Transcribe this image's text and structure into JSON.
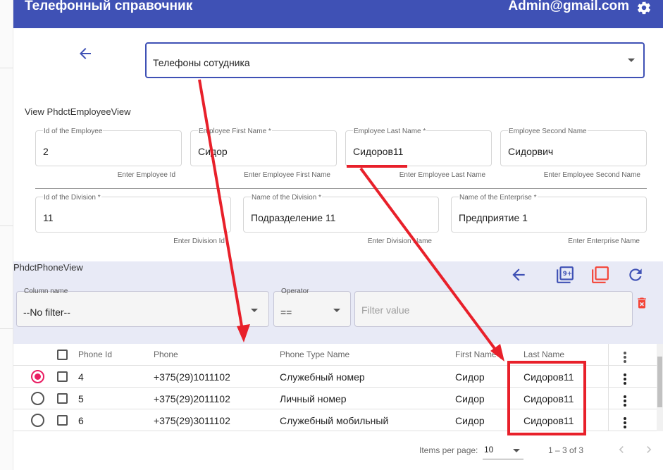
{
  "app": {
    "title": "Телефонный справочник",
    "user": "Admin@gmail.com",
    "settings_icon": "gear-icon"
  },
  "selector": {
    "value": "Телефоны сотудника"
  },
  "employee_view": {
    "title": "View PhdctEmployeeView",
    "fields": {
      "id": {
        "label": "Id of the Employee",
        "value": "2",
        "hint": "Enter Employee Id"
      },
      "first_name": {
        "label": "Employee First Name *",
        "value": "Сидор",
        "hint": "Enter Employee First Name"
      },
      "last_name": {
        "label": "Employee Last Name *",
        "value": "Сидоров11",
        "hint": "Enter Employee Last Name"
      },
      "second_name": {
        "label": "Employee Second Name",
        "value": "Сидорвич",
        "hint": "Enter Employee Second Name"
      },
      "division_id": {
        "label": "Id of the Division *",
        "value": "11",
        "hint": "Enter Division Id"
      },
      "division_name": {
        "label": "Name of the Division *",
        "value": "Подразделение 11",
        "hint": "Enter Division Name"
      },
      "enterprise_name": {
        "label": "Name of the Enterprise *",
        "value": "Предприятие 1",
        "hint": "Enter Enterprise Name"
      }
    }
  },
  "phone_view": {
    "title": "PhdctPhoneView",
    "filter": {
      "column_label": "Column name",
      "column_value": "--No filter--",
      "operator_label": "Operator",
      "operator_value": "==",
      "value_placeholder": "Filter value"
    },
    "columns": [
      "Phone Id",
      "Phone",
      "Phone Type Name",
      "First Name",
      "Last Name"
    ],
    "rows": [
      {
        "selected": true,
        "id": "4",
        "phone": "+375(29)1011102",
        "type": "Служебный номер",
        "first": "Сидор",
        "last": "Сидоров11"
      },
      {
        "selected": false,
        "id": "5",
        "phone": "+375(29)2011102",
        "type": "Личный номер",
        "first": "Сидор",
        "last": "Сидоров11"
      },
      {
        "selected": false,
        "id": "6",
        "phone": "+375(29)3011102",
        "type": "Служебный мобильный",
        "first": "Сидор",
        "last": "Сидоров11"
      }
    ],
    "paginator": {
      "items_label": "Items per page:",
      "page_size": "10",
      "range": "1 – 3 of 3"
    }
  },
  "colors": {
    "primary": "#3f51b5",
    "accent": "#e91e63",
    "danger": "#f44336",
    "annotation": "#e8202a",
    "panel": "#e8eaf6"
  }
}
